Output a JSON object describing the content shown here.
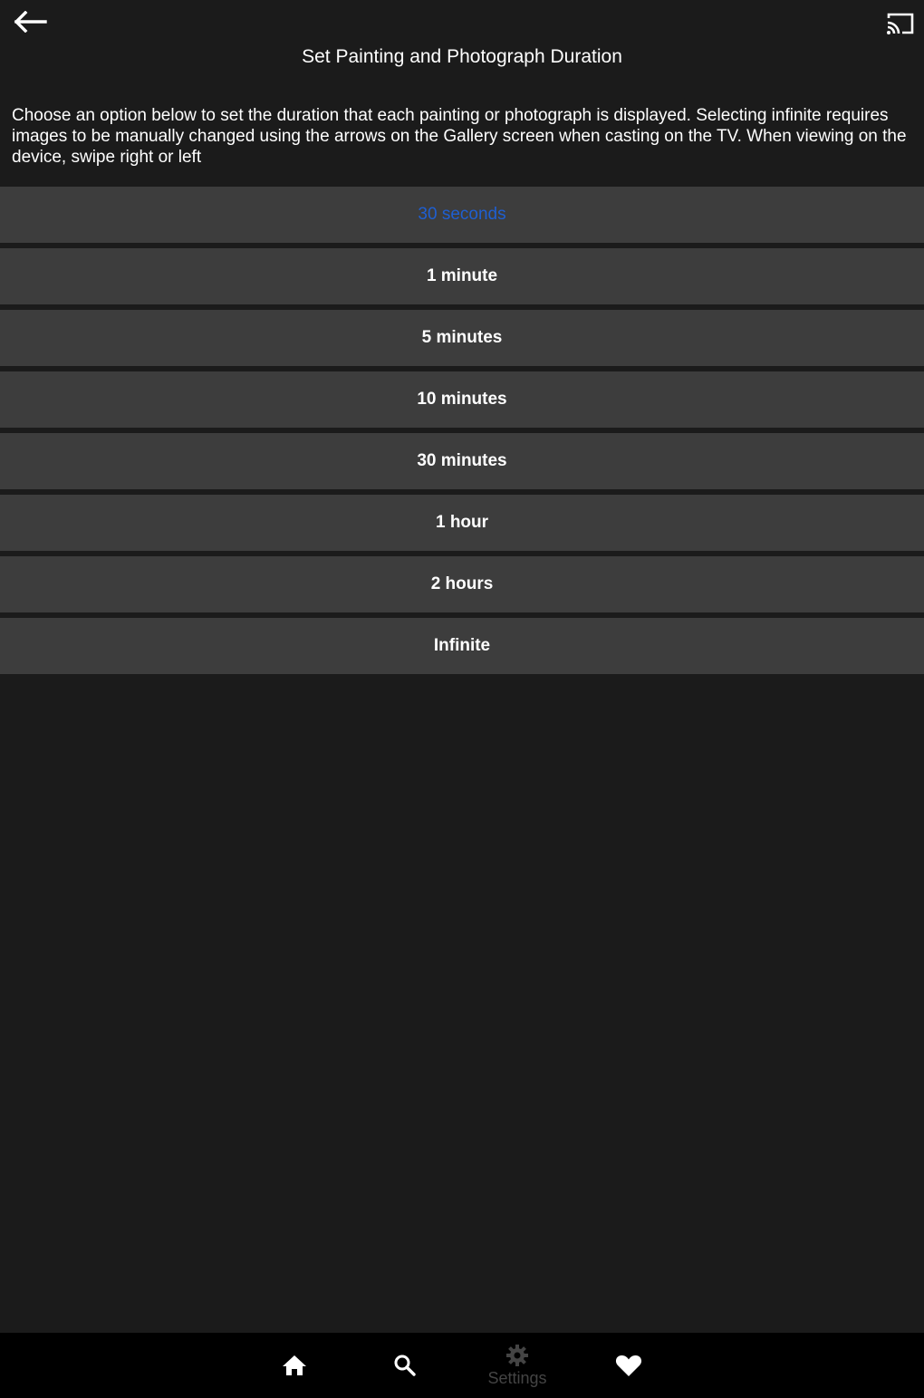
{
  "header": {
    "back_icon": "arrow-left-icon",
    "cast_icon": "cast-icon",
    "title": "Set Painting and Photograph Duration",
    "description": "Choose an option below to set the duration that each painting or photograph is displayed. Selecting infinite requires images to be manually changed using the arrows on the Gallery screen when casting on the TV. When viewing on the device, swipe right or left"
  },
  "options": [
    {
      "label": "30 seconds",
      "selected": true
    },
    {
      "label": "1 minute",
      "selected": false
    },
    {
      "label": "5 minutes",
      "selected": false
    },
    {
      "label": "10 minutes",
      "selected": false
    },
    {
      "label": "30 minutes",
      "selected": false
    },
    {
      "label": "1 hour",
      "selected": false
    },
    {
      "label": "2 hours",
      "selected": false
    },
    {
      "label": "Infinite",
      "selected": false
    }
  ],
  "bottom_nav": {
    "home_icon": "home-icon",
    "search_icon": "search-icon",
    "settings_icon": "gear-icon",
    "settings_label": "Settings",
    "favorites_icon": "heart-icon",
    "active": "settings"
  },
  "colors": {
    "background": "#1b1b1b",
    "option_background": "#3d3d3d",
    "selected_text": "#1f5fd1",
    "nav_background": "#000000",
    "nav_inactive": "#444444"
  }
}
